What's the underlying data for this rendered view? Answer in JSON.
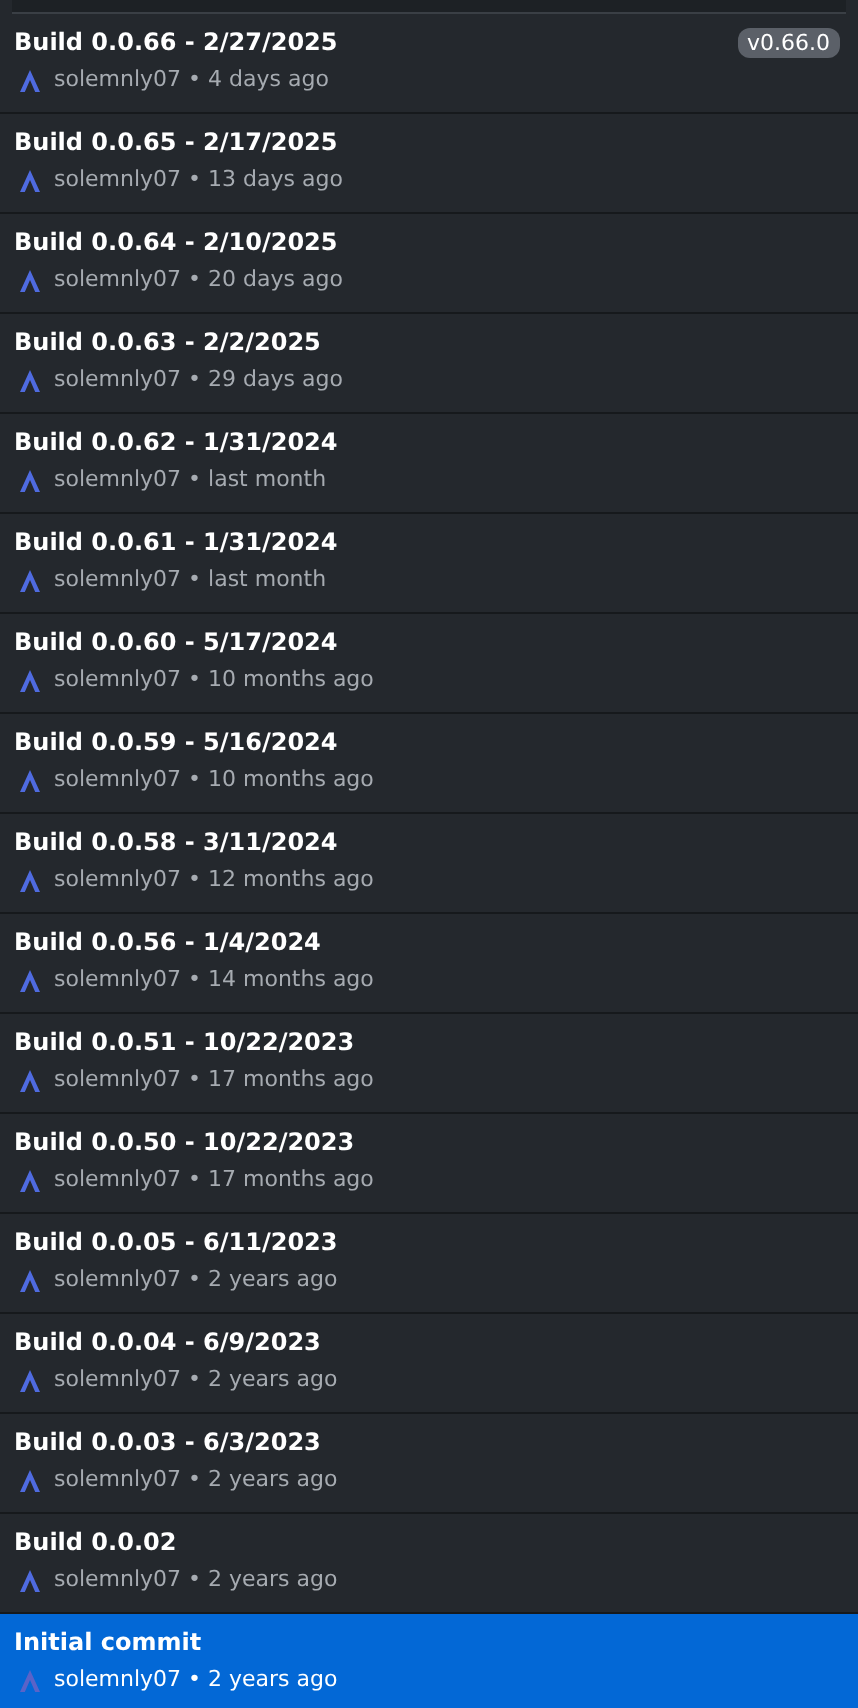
{
  "commits": [
    {
      "title": "Build 0.0.66 - 2/27/2025",
      "meta": "solemnly07 • 4 days ago",
      "tag": "v0.66.0",
      "selected": false
    },
    {
      "title": "Build 0.0.65 - 2/17/2025",
      "meta": "solemnly07 • 13 days ago",
      "selected": false
    },
    {
      "title": "Build 0.0.64 - 2/10/2025",
      "meta": "solemnly07 • 20 days ago",
      "selected": false
    },
    {
      "title": "Build 0.0.63 - 2/2/2025",
      "meta": "solemnly07 • 29 days ago",
      "selected": false
    },
    {
      "title": "Build 0.0.62 - 1/31/2024",
      "meta": "solemnly07 • last month",
      "selected": false
    },
    {
      "title": "Build 0.0.61 - 1/31/2024",
      "meta": "solemnly07 • last month",
      "selected": false
    },
    {
      "title": "Build 0.0.60 - 5/17/2024",
      "meta": "solemnly07 • 10 months ago",
      "selected": false
    },
    {
      "title": "Build 0.0.59 - 5/16/2024",
      "meta": "solemnly07 • 10 months ago",
      "selected": false
    },
    {
      "title": "Build 0.0.58 - 3/11/2024",
      "meta": "solemnly07 • 12 months ago",
      "selected": false
    },
    {
      "title": "Build 0.0.56 - 1/4/2024",
      "meta": "solemnly07 • 14 months ago",
      "selected": false
    },
    {
      "title": "Build 0.0.51 - 10/22/2023",
      "meta": "solemnly07 • 17 months ago",
      "selected": false
    },
    {
      "title": "Build 0.0.50 - 10/22/2023",
      "meta": "solemnly07 • 17 months ago",
      "selected": false
    },
    {
      "title": "Build 0.0.05 - 6/11/2023",
      "meta": "solemnly07 • 2 years ago",
      "selected": false
    },
    {
      "title": "Build 0.0.04 - 6/9/2023",
      "meta": "solemnly07 • 2 years ago",
      "selected": false
    },
    {
      "title": "Build 0.0.03 - 6/3/2023",
      "meta": "solemnly07 • 2 years ago",
      "selected": false
    },
    {
      "title": "Build 0.0.02",
      "meta": "solemnly07 • 2 years ago",
      "selected": false
    },
    {
      "title": "Initial commit",
      "meta": "solemnly07 • 2 years ago",
      "selected": true
    }
  ]
}
